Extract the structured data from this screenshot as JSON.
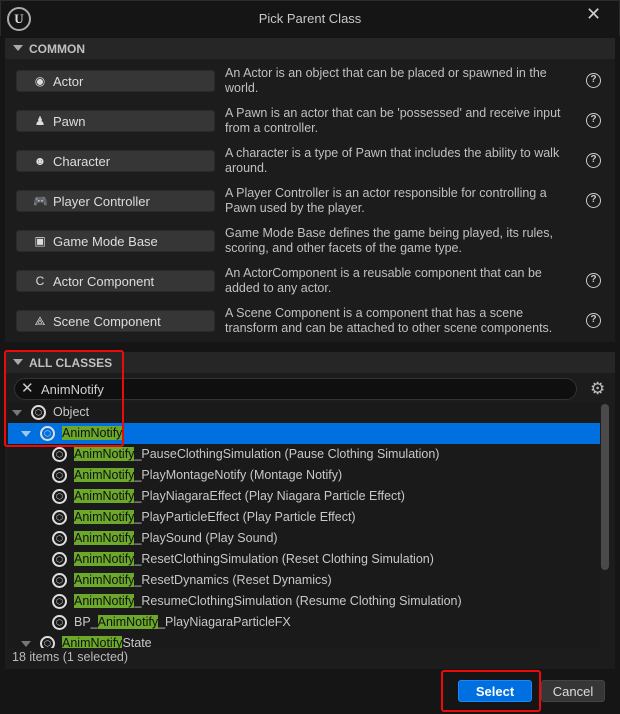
{
  "window": {
    "title": "Pick Parent Class",
    "logo": "unreal-engine-logo",
    "close_icon": "close-icon"
  },
  "common": {
    "header": "COMMON",
    "items": [
      {
        "label": "Actor",
        "icon": "actor-icon",
        "desc": "An Actor is an object that can be placed or spawned in the world.",
        "help": true
      },
      {
        "label": "Pawn",
        "icon": "pawn-icon",
        "desc": "A Pawn is an actor that can be 'possessed' and receive input from a controller.",
        "help": true
      },
      {
        "label": "Character",
        "icon": "character-icon",
        "desc": "A character is a type of Pawn that includes the ability to walk around.",
        "help": true
      },
      {
        "label": "Player Controller",
        "icon": "gamepad-icon",
        "desc": "A Player Controller is an actor responsible for controlling a Pawn used by the player.",
        "help": true
      },
      {
        "label": "Game Mode Base",
        "icon": "game-mode-icon",
        "desc": "Game Mode Base defines the game being played, its rules, scoring, and other facets of the game type.",
        "help": false
      },
      {
        "label": "Actor Component",
        "icon": "actor-component-icon",
        "desc": "An ActorComponent is a reusable component that can be added to any actor.",
        "help": true
      },
      {
        "label": "Scene Component",
        "icon": "scene-component-icon",
        "desc": "A Scene Component is a component that has a scene transform and can be attached to other scene components.",
        "help": true
      }
    ]
  },
  "all_classes": {
    "header": "ALL CLASSES",
    "search_value": "AnimNotify",
    "highlight_color": "#6ca92a",
    "selection_color": "#0070e0",
    "tree": [
      {
        "pre": "",
        "match": "",
        "post": "Object",
        "level": 0,
        "expanded": true,
        "selected": false
      },
      {
        "pre": "",
        "match": "AnimNotify",
        "post": "",
        "level": 1,
        "expanded": true,
        "selected": true
      },
      {
        "pre": "",
        "match": "AnimNotify",
        "post": "_PauseClothingSimulation (Pause Clothing Simulation)",
        "level": 2
      },
      {
        "pre": "",
        "match": "AnimNotify",
        "post": "_PlayMontageNotify (Montage Notify)",
        "level": 2
      },
      {
        "pre": "",
        "match": "AnimNotify",
        "post": "_PlayNiagaraEffect (Play Niagara Particle Effect)",
        "level": 2
      },
      {
        "pre": "",
        "match": "AnimNotify",
        "post": "_PlayParticleEffect (Play Particle Effect)",
        "level": 2
      },
      {
        "pre": "",
        "match": "AnimNotify",
        "post": "_PlaySound (Play Sound)",
        "level": 2
      },
      {
        "pre": "",
        "match": "AnimNotify",
        "post": "_ResetClothingSimulation (Reset Clothing Simulation)",
        "level": 2
      },
      {
        "pre": "",
        "match": "AnimNotify",
        "post": "_ResetDynamics (Reset Dynamics)",
        "level": 2
      },
      {
        "pre": "",
        "match": "AnimNotify",
        "post": "_ResumeClothingSimulation (Resume Clothing Simulation)",
        "level": 2
      },
      {
        "pre": "BP_",
        "match": "AnimNotify",
        "post": "_PlayNiagaraParticleFX",
        "level": 2
      },
      {
        "pre": "",
        "match": "AnimNotify",
        "post": "State",
        "level": 1,
        "expanded": true
      }
    ],
    "status": "18 items (1 selected)"
  },
  "footer": {
    "select": "Select",
    "cancel": "Cancel"
  },
  "annotation_color": "#ee0a0a"
}
